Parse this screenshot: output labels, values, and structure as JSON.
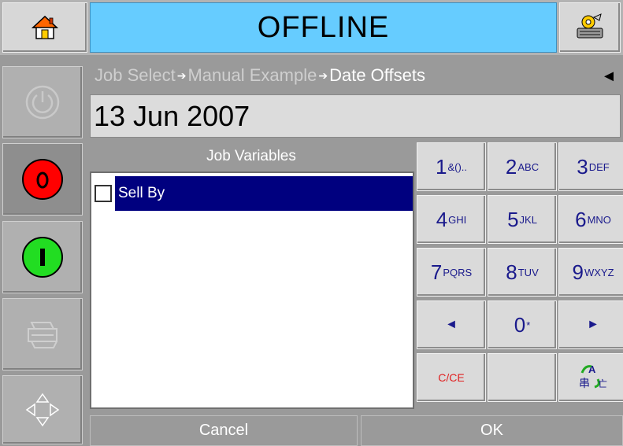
{
  "header": {
    "home_icon": "home-icon",
    "status": "OFFLINE",
    "status_color": "#66ccff",
    "tools_icon": "tools-icon"
  },
  "side_buttons": [
    {
      "icon": "power-icon",
      "enabled": false
    },
    {
      "icon": "stop-icon",
      "glyph": "O",
      "color": "#ff0000"
    },
    {
      "icon": "start-icon",
      "glyph": "I",
      "color": "#22cc22"
    },
    {
      "icon": "printer-icon",
      "enabled": false
    },
    {
      "icon": "direction-arrows-icon",
      "enabled": true
    }
  ],
  "breadcrumb": {
    "items": [
      "Job Select",
      "Manual Example",
      "Date Offsets"
    ],
    "separator": "➔"
  },
  "date_value": "13 Jun 2007",
  "job_variables": {
    "title": "Job Variables",
    "items": [
      {
        "label": "Sell By",
        "checked": false,
        "selected": true
      }
    ]
  },
  "keypad": {
    "keys": [
      {
        "digit": "1",
        "sub": "&()..",
        "name": "key-1"
      },
      {
        "digit": "2",
        "sub": "ABC",
        "name": "key-2"
      },
      {
        "digit": "3",
        "sub": "DEF",
        "name": "key-3"
      },
      {
        "digit": "4",
        "sub": "GHI",
        "name": "key-4"
      },
      {
        "digit": "5",
        "sub": "JKL",
        "name": "key-5"
      },
      {
        "digit": "6",
        "sub": "MNO",
        "name": "key-6"
      },
      {
        "digit": "7",
        "sub": "PQRS",
        "name": "key-7"
      },
      {
        "digit": "8",
        "sub": "TUV",
        "name": "key-8"
      },
      {
        "digit": "9",
        "sub": "WXYZ",
        "name": "key-9"
      },
      {
        "digit": "◄",
        "sub": "",
        "name": "key-left"
      },
      {
        "digit": "0",
        "sub": "*",
        "name": "key-0"
      },
      {
        "digit": "►",
        "sub": "",
        "name": "key-right"
      },
      {
        "digit": "C/CE",
        "sub": "",
        "name": "key-clear",
        "color": "#e02020"
      },
      {
        "digit": "",
        "sub": "",
        "name": "key-blank"
      },
      {
        "digit": "",
        "sub": "",
        "name": "key-input-mode",
        "icon": "input-language-icon"
      }
    ]
  },
  "buttons": {
    "cancel": "Cancel",
    "ok": "OK"
  }
}
